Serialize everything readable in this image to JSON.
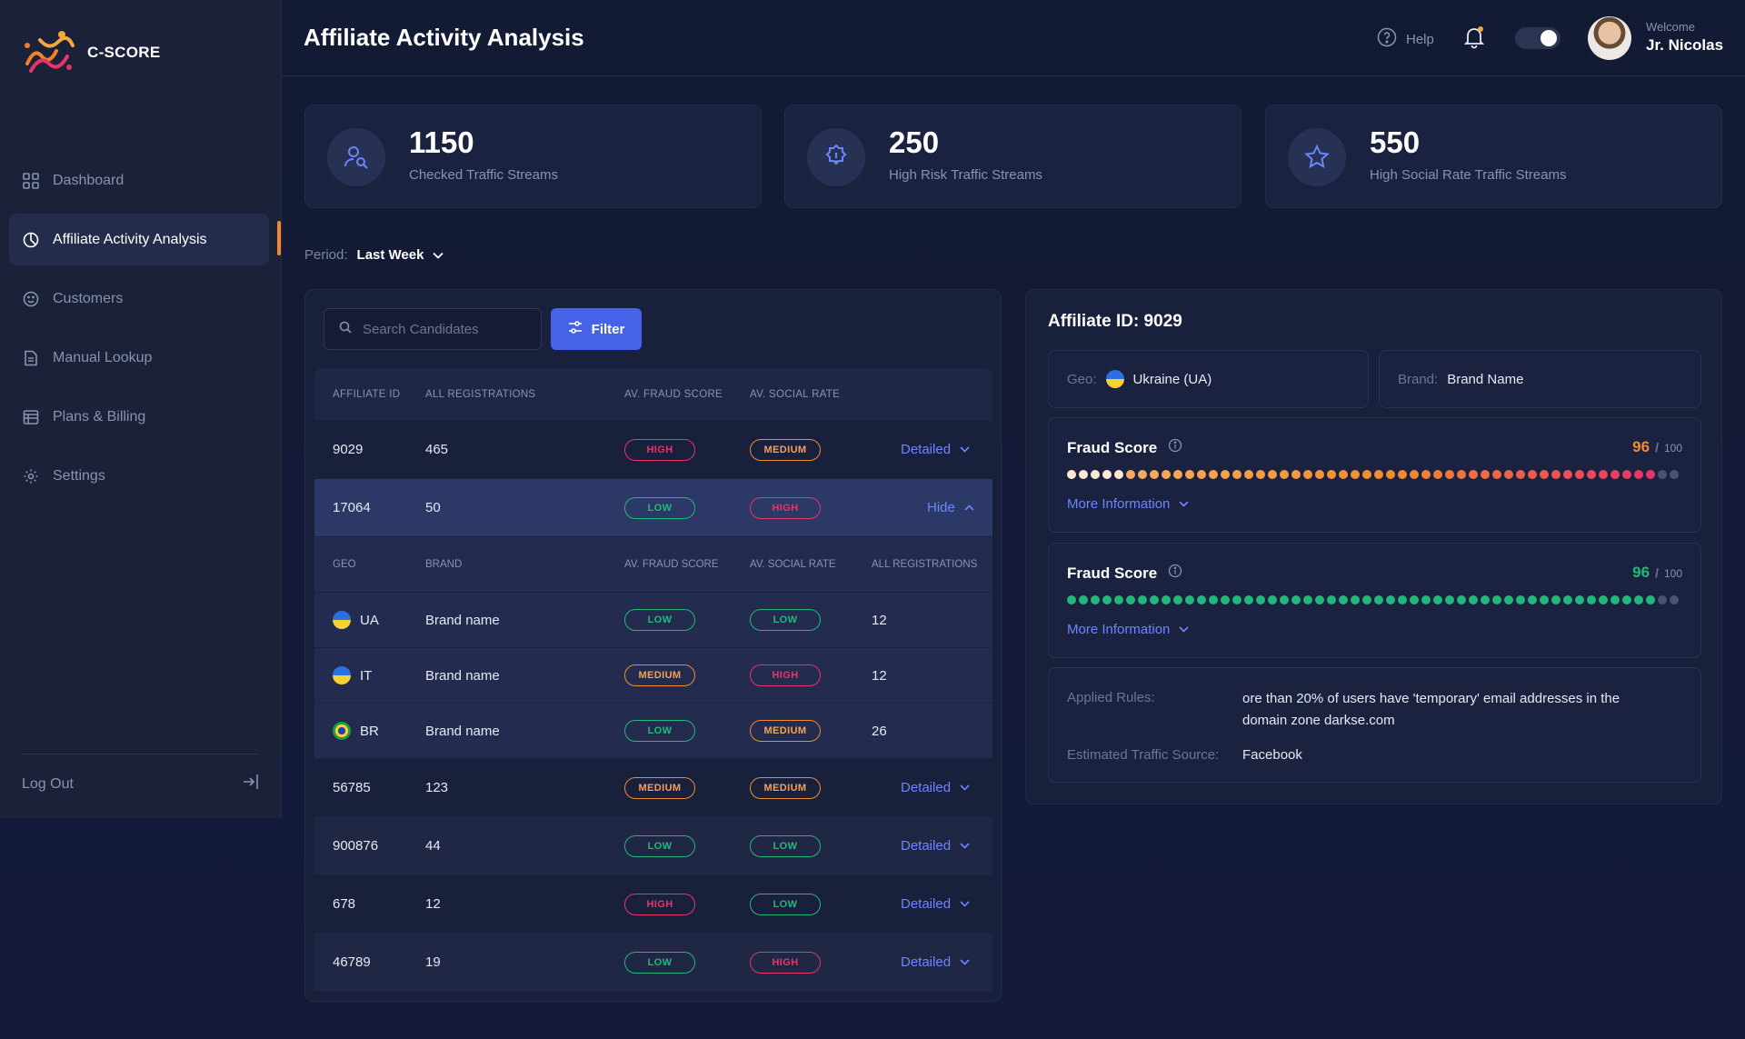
{
  "brand": {
    "name": "C-SCORE"
  },
  "sidebar": {
    "items": [
      {
        "label": "Dashboard",
        "icon": "grid-icon"
      },
      {
        "label": "Affiliate Activity Analysis",
        "icon": "pie-chart-icon",
        "active": true
      },
      {
        "label": "Customers",
        "icon": "smile-icon"
      },
      {
        "label": "Manual Lookup",
        "icon": "document-icon"
      },
      {
        "label": "Plans & Billing",
        "icon": "billing-icon"
      },
      {
        "label": "Settings",
        "icon": "gear-icon"
      }
    ],
    "logout": "Log Out"
  },
  "header": {
    "title": "Affiliate Activity Analysis",
    "help": "Help",
    "welcome": "Welcome",
    "username": "Jr. Nicolas"
  },
  "stats": [
    {
      "value": "1150",
      "label": "Checked Traffic Streams",
      "icon": "user-search-icon"
    },
    {
      "value": "250",
      "label": "High Risk Traffic Streams",
      "icon": "alert-badge-icon"
    },
    {
      "value": "550",
      "label": "High Social Rate Traffic Streams",
      "icon": "star-badge-icon"
    }
  ],
  "period": {
    "label": "Period:",
    "value": "Last Week"
  },
  "search": {
    "placeholder": "Search Candidates"
  },
  "filter": {
    "label": "Filter"
  },
  "table": {
    "headers": [
      "AFFILIATE ID",
      "ALL REGISTRATIONS",
      "AV. FRAUD SCORE",
      "AV. SOCIAL RATE"
    ],
    "sub_headers": [
      "GEO",
      "BRAND",
      "AV. FRAUD SCORE",
      "AV. SOCIAL RATE",
      "ALL REGISTRATIONS"
    ],
    "rows": [
      {
        "id": "9029",
        "regs": "465",
        "fraud": "HIGH",
        "social": "MEDIUM",
        "action": "Detailed"
      },
      {
        "id": "17064",
        "regs": "50",
        "fraud": "LOW",
        "social": "HIGH",
        "action": "Hide"
      },
      {
        "id": "56785",
        "regs": "123",
        "fraud": "MEDIUM",
        "social": "MEDIUM",
        "action": "Detailed"
      },
      {
        "id": "900876",
        "regs": "44",
        "fraud": "LOW",
        "social": "LOW",
        "action": "Detailed"
      },
      {
        "id": "678",
        "regs": "12",
        "fraud": "HIGH",
        "social": "LOW",
        "action": "Detailed"
      },
      {
        "id": "46789",
        "regs": "19",
        "fraud": "LOW",
        "social": "HIGH",
        "action": "Detailed"
      }
    ],
    "sub_rows": [
      {
        "geo": "UA",
        "brand": "Brand name",
        "fraud": "LOW",
        "social": "LOW",
        "regs": "12"
      },
      {
        "geo": "IT",
        "brand": "Brand name",
        "fraud": "MEDIUM",
        "social": "HIGH",
        "regs": "12"
      },
      {
        "geo": "BR",
        "brand": "Brand name",
        "fraud": "LOW",
        "social": "MEDIUM",
        "regs": "26"
      }
    ]
  },
  "detail": {
    "title": "Affiliate ID: 9029",
    "geo_label": "Geo:",
    "geo_value": "Ukraine (UA)",
    "brand_label": "Brand:",
    "brand_value": "Brand Name",
    "scores": [
      {
        "title": "Fraud Score",
        "value": "96",
        "max": "100",
        "color": "#f28b2e",
        "filled": 0.96,
        "style": "gradient"
      },
      {
        "title": "Fraud Score",
        "value": "96",
        "max": "100",
        "color": "#22b879",
        "filled": 0.96,
        "style": "green"
      }
    ],
    "more": "More Information",
    "rules_label": "Applied Rules:",
    "rules_value": "ore than 20% of users have 'temporary' email addresses in the domain zone darkse.com",
    "source_label": "Estimated Traffic Source:",
    "source_value": "Facebook"
  }
}
